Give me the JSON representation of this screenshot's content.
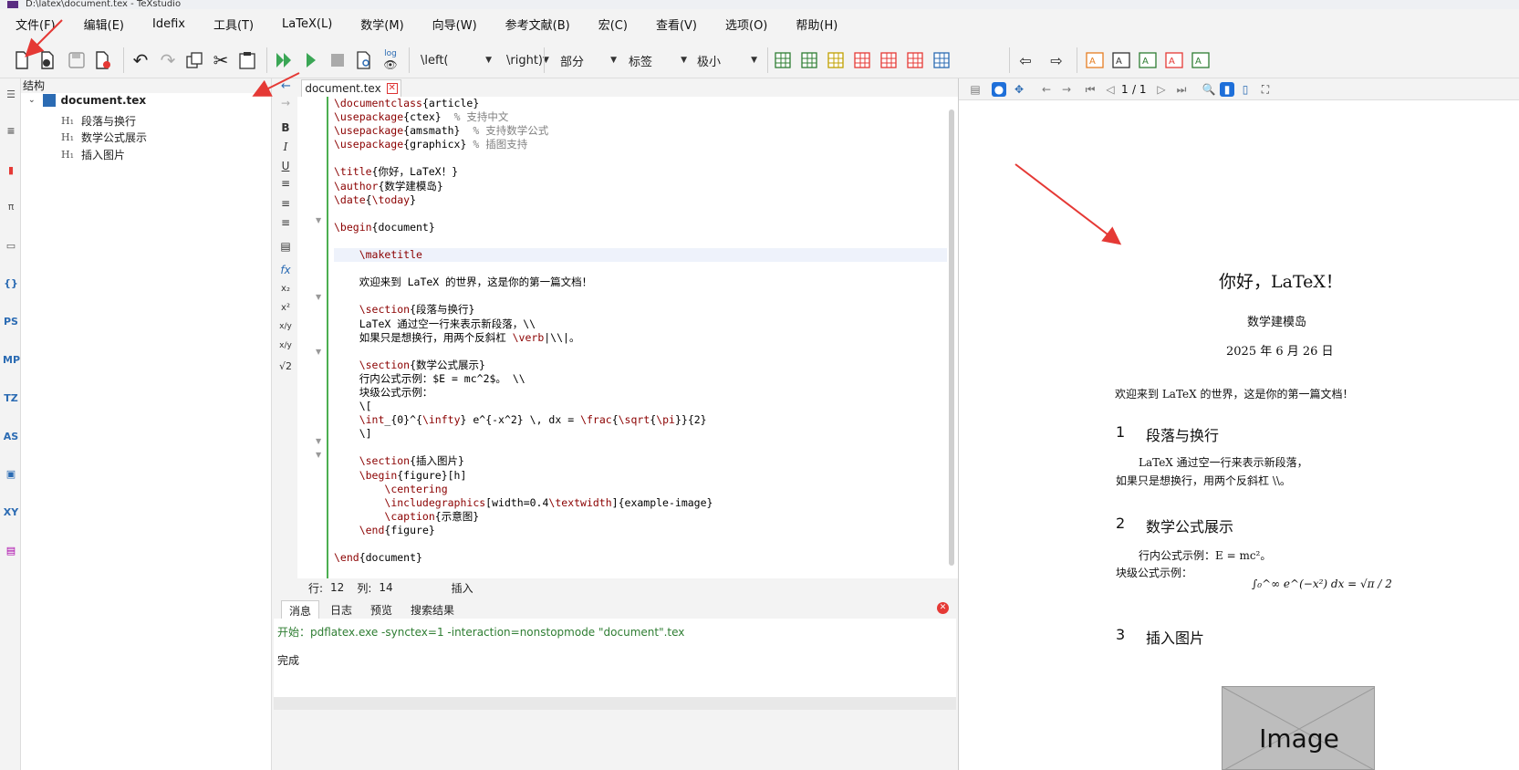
{
  "window": {
    "title": "D:\\latex\\document.tex - TeXstudio"
  },
  "menu": [
    "文件(F)",
    "编辑(E)",
    "Idefix",
    "工具(T)",
    "LaTeX(L)",
    "数学(M)",
    "向导(W)",
    "参考文献(B)",
    "宏(C)",
    "查看(V)",
    "选项(O)",
    "帮助(H)"
  ],
  "toolbar": {
    "combo_left": "\\left(",
    "combo_right": "\\right)",
    "combo_section": "部分",
    "combo_label": "标签",
    "combo_size": "极小",
    "log_label": "log"
  },
  "structure": {
    "header": "结构",
    "root": "document.tex",
    "sections": [
      "段落与换行",
      "数学公式展示",
      "插入图片"
    ]
  },
  "editor": {
    "tab_name": "document.tex",
    "lines": [
      "\\documentclass{article}",
      "\\usepackage{ctex}  % 支持中文",
      "\\usepackage{amsmath}  % 支持数学公式",
      "\\usepackage{graphicx} % 插图支持",
      "",
      "\\title{你好，LaTeX！}",
      "\\author{数学建模岛}",
      "\\date{\\today}",
      "",
      "\\begin{document}",
      "",
      "    \\maketitle",
      "",
      "    欢迎来到 LaTeX 的世界，这是你的第一篇文档！",
      "",
      "    \\section{段落与换行}",
      "    LaTeX 通过空一行来表示新段落，\\\\",
      "    如果只是想换行，用两个反斜杠 \\verb|\\\\|。",
      "",
      "    \\section{数学公式展示}",
      "    行内公式示例：$E = mc^2$。 \\\\",
      "    块级公式示例：",
      "    \\[",
      "    \\int_{0}^{\\infty} e^{-x^2} \\, dx = \\frac{\\sqrt{\\pi}}{2}",
      "    \\]",
      "",
      "    \\section{插入图片}",
      "    \\begin{figure}[h]",
      "        \\centering",
      "        \\includegraphics[width=0.4\\textwidth]{example-image}",
      "        \\caption{示意图}",
      "    \\end{figure}",
      "",
      "\\end{document}"
    ],
    "status": {
      "row_label": "行:",
      "row": "12",
      "col_label": "列:",
      "col": "14",
      "mode": "插入"
    }
  },
  "messages": {
    "tabs": [
      "消息",
      "日志",
      "预览",
      "搜索结果"
    ],
    "line1": "开始：pdflatex.exe -synctex=1 -interaction=nonstopmode \"document\".tex",
    "line2": "完成"
  },
  "pdf": {
    "page": "1",
    "pages": "/ 1",
    "title": "你好，LaTeX！",
    "author": "数学建模岛",
    "date": "2025 年 6 月 26 日",
    "intro": "欢迎来到 LaTeX 的世界，这是你的第一篇文档！",
    "s1_num": "1",
    "s1": "段落与换行",
    "p1a": "LaTeX 通过空一行来表示新段落，",
    "p1b": "如果只是想换行，用两个反斜杠 \\\\。",
    "s2_num": "2",
    "s2": "数学公式展示",
    "p2a": "行内公式示例：E = mc²。",
    "p2b": "块级公式示例：",
    "formula": "∫₀^∞ e^(−x²) dx = √π / 2",
    "s3_num": "3",
    "s3": "插入图片",
    "image_text": "Image"
  },
  "colors": {
    "accent": "#2b6bb3",
    "arrow": "#e53935",
    "green": "#4caf50"
  }
}
